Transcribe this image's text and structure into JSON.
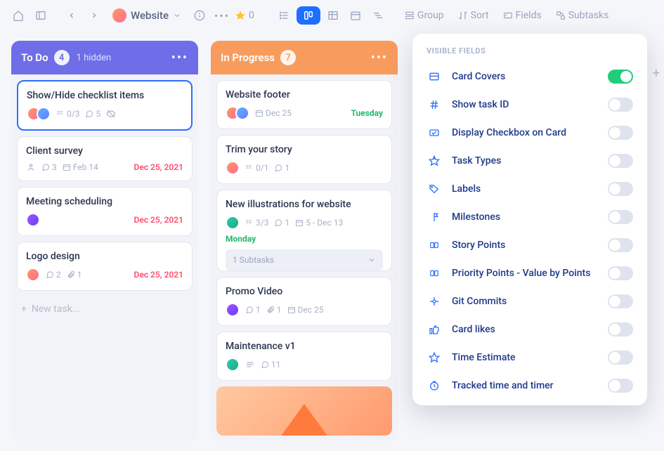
{
  "project": {
    "name": "Website"
  },
  "toolbar": {
    "star_count": "0",
    "group": "Group",
    "sort": "Sort",
    "fields": "Fields",
    "subtasks": "Subtasks"
  },
  "columns": [
    {
      "title": "To Do",
      "count": "4",
      "hidden": "1 hidden",
      "color": "purple",
      "cards": [
        {
          "title": "Show/Hide checklist items",
          "selected": true,
          "avatars": [
            "orange",
            "blue"
          ],
          "checklist": "0/3",
          "comments": "5",
          "hidden": true
        },
        {
          "title": "Client survey",
          "avatars": [],
          "people_icon": true,
          "comments": "3",
          "date": "Feb 14",
          "due_right": "Dec 25, 2021"
        },
        {
          "title": "Meeting scheduling",
          "avatars": [
            "plum"
          ],
          "due_right": "Dec 25, 2021"
        },
        {
          "title": "Logo design",
          "avatars": [
            "orange"
          ],
          "comments": "2",
          "attach": "1",
          "due_right": "Dec 25, 2021"
        }
      ],
      "new_task": "New task..."
    },
    {
      "title": "In Progress",
      "count": "7",
      "color": "orange",
      "cards": [
        {
          "title": "Website footer",
          "avatars": [
            "orange",
            "blue"
          ],
          "date": "Dec 25",
          "due_right": "Tuesday",
          "due_right_green": true
        },
        {
          "title": "Trim your story",
          "avatars": [
            "orange"
          ],
          "checklist": "0/1",
          "comments": "1"
        },
        {
          "title": "New illustrations for website",
          "avatars": [
            "teal"
          ],
          "checklist": "3/3",
          "comments": "1",
          "date_range": "5 - Dec 13",
          "below": "Monday",
          "subtasks": "1 Subtasks"
        },
        {
          "title": "Promo Video",
          "avatars": [
            "plum"
          ],
          "comments": "1",
          "attach": "1",
          "date": "Dec 25"
        },
        {
          "title": "Maintenance v1",
          "avatars": [
            "teal"
          ],
          "lines": true,
          "comments": "11"
        }
      ]
    }
  ],
  "dropdown": {
    "title": "VISIBLE FIELDS",
    "items": [
      {
        "icon": "card-covers",
        "label": "Card Covers",
        "on": true
      },
      {
        "icon": "hash",
        "label": "Show task ID",
        "on": false
      },
      {
        "icon": "checkbox",
        "label": "Display Checkbox on Card",
        "on": false
      },
      {
        "icon": "task-types",
        "label": "Task Types",
        "on": false
      },
      {
        "icon": "labels",
        "label": "Labels",
        "on": false
      },
      {
        "icon": "milestones",
        "label": "Milestones",
        "on": false
      },
      {
        "icon": "story-points",
        "label": "Story Points",
        "on": false
      },
      {
        "icon": "priority-points",
        "label": "Priority Points - Value by Points",
        "on": false
      },
      {
        "icon": "git",
        "label": "Git Commits",
        "on": false
      },
      {
        "icon": "likes",
        "label": "Card likes",
        "on": false
      },
      {
        "icon": "time-estimate",
        "label": "Time Estimate",
        "on": false
      },
      {
        "icon": "timer",
        "label": "Tracked time and timer",
        "on": false
      }
    ]
  }
}
